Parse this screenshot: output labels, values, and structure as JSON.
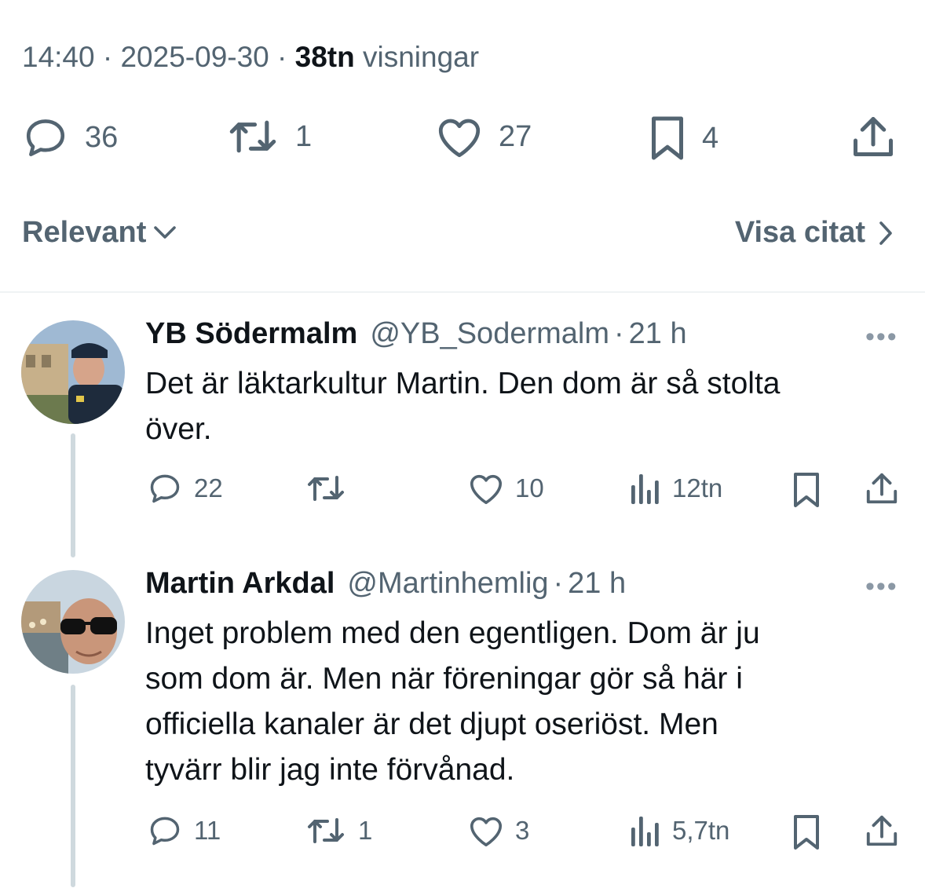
{
  "post": {
    "time": "14:40",
    "date": "2025-09-30",
    "views_count": "38tn",
    "views_label": "visningar",
    "stats": {
      "replies": "36",
      "reposts": "1",
      "likes": "27",
      "bookmarks": "4"
    }
  },
  "controls": {
    "sort_label": "Relevant",
    "quotes_label": "Visa citat"
  },
  "replies": [
    {
      "name": "YB Södermalm",
      "handle": "@YB_Sodermalm",
      "age": "21 h",
      "text_lines": [
        "Det är läktarkultur Martin. Den dom är så stolta",
        "över."
      ],
      "replies": "22",
      "reposts": "",
      "likes": "10",
      "views": "12tn"
    },
    {
      "name": "Martin Arkdal",
      "handle": "@Martinhemlig",
      "age": "21 h",
      "text_lines": [
        "Inget problem med den egentligen. Dom är ju",
        "som dom är. Men när föreningar gör så här i",
        "officiella kanaler är det djupt oseriöst. Men",
        "tyvärr blir jag inte förvånad."
      ],
      "replies": "11",
      "reposts": "1",
      "likes": "3",
      "views": "5,7tn"
    }
  ],
  "icons": {
    "reply": "speech-bubble-icon",
    "repost": "repost-arrows-icon",
    "like": "heart-icon",
    "views": "bar-chart-icon",
    "bookmark": "bookmark-icon",
    "share": "share-upload-icon",
    "more": "more-dots-icon"
  },
  "colors": {
    "text": "#0f1419",
    "secondary": "#536471",
    "divider": "#eff3f4",
    "thread_line": "#cfd9de"
  }
}
